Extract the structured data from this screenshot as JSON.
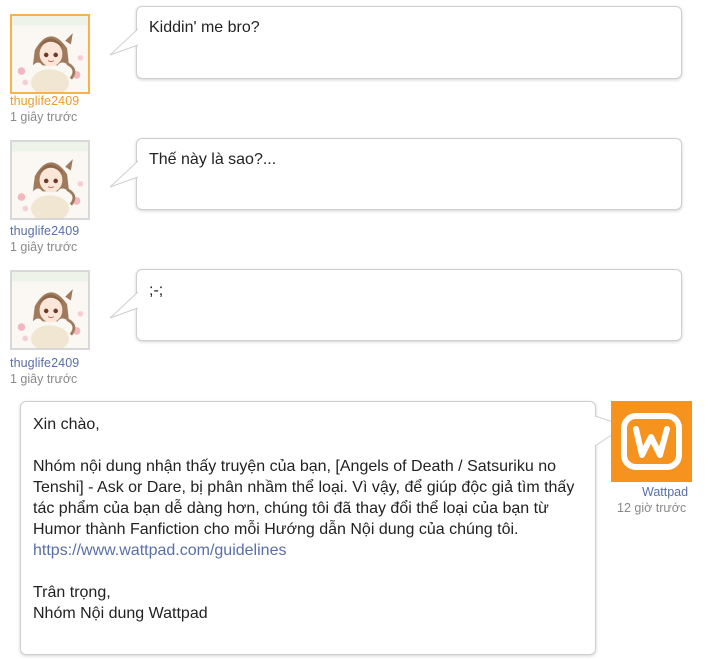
{
  "messages": [
    {
      "user": "thuglife2409",
      "time": "1 giây trước",
      "text": "Kiddin' me bro?"
    },
    {
      "user": "thuglife2409",
      "time": "1 giây trước",
      "text": "Thế này là sao?..."
    },
    {
      "user": "thuglife2409",
      "time": "1 giây trước",
      "text": ";-;"
    }
  ],
  "wattpad_message": {
    "user": "Wattpad",
    "time": "12 giờ trước",
    "greeting": "Xin chào,",
    "body": "Nhóm nội dung nhận thấy truyện của bạn, [Angels of Death / Satsuriku no Tenshi] - Ask or Dare, bị phân nhầm thể loại. Vì vậy, để giúp độc giả tìm thấy tác phẩm của bạn dễ dàng hơn, chúng tôi đã thay đổi thể loại của bạn từ Humor thành Fanfiction cho mỗi Hướng dẫn Nội dung của chúng tôi.",
    "link": "https://www.wattpad.com/guidelines",
    "closing": "Trân trọng,",
    "signature": "Nhóm Nội dung Wattpad"
  },
  "colors": {
    "username_link": "#5a6fa8",
    "active_username": "#f09a2a",
    "wattpad_orange": "#f6921e",
    "timestamp": "#8a8a8a"
  },
  "icons": {
    "user_avatar": "anime-character-avatar",
    "wattpad_logo": "wattpad-w-logo"
  }
}
